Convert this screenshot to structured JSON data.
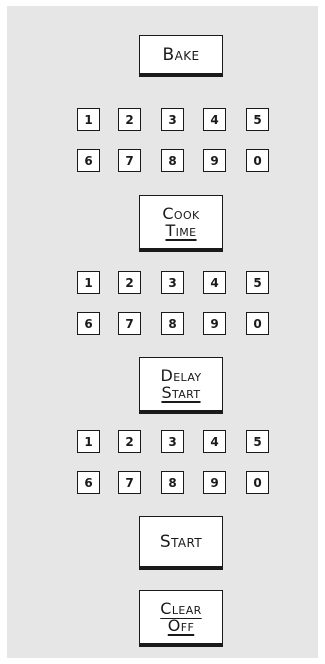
{
  "colors": {
    "panel": "#e6e6e6",
    "key_face": "#ffffff",
    "key_border": "#1a1a1a",
    "text": "#1a1a1a"
  },
  "bake": {
    "label": "Bake"
  },
  "cook_time": {
    "line1": "Cook",
    "line2": "Time"
  },
  "delay_start": {
    "line1": "Delay",
    "line2": "Start"
  },
  "start": {
    "label": "Start"
  },
  "clear_off": {
    "line1": "Clear",
    "line2": "Off"
  },
  "keypads": [
    {
      "row1": [
        "1",
        "2",
        "3",
        "4",
        "5"
      ],
      "row2": [
        "6",
        "7",
        "8",
        "9",
        "0"
      ]
    },
    {
      "row1": [
        "1",
        "2",
        "3",
        "4",
        "5"
      ],
      "row2": [
        "6",
        "7",
        "8",
        "9",
        "0"
      ]
    },
    {
      "row1": [
        "1",
        "2",
        "3",
        "4",
        "5"
      ],
      "row2": [
        "6",
        "7",
        "8",
        "9",
        "0"
      ]
    }
  ]
}
